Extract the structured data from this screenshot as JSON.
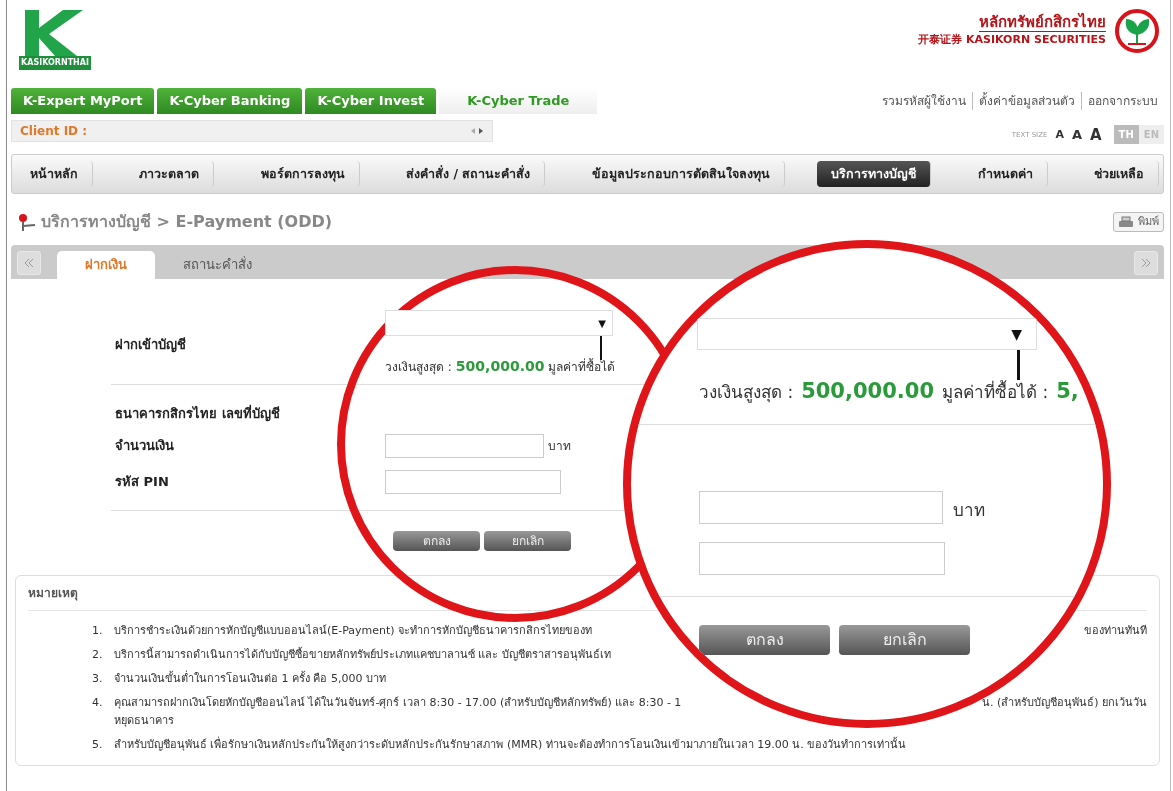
{
  "header": {
    "logo_caption": "KASIKORNTHAI",
    "brand_thai": "หลักทรัพย์กสิกรไทย",
    "brand_sub": "开泰证券 KASIKORN SECURITIES"
  },
  "product_tabs": [
    {
      "label": "K-Expert MyPort",
      "selected": false
    },
    {
      "label": "K-Cyber Banking",
      "selected": false
    },
    {
      "label": "K-Cyber Invest",
      "selected": false
    },
    {
      "label": "K-Cyber Trade",
      "selected": true
    }
  ],
  "user_links": [
    "รวมรหัสผู้ใช้งาน",
    "ตั้งค่าข้อมูลส่วนตัว",
    "ออกจากระบบ"
  ],
  "client_id": {
    "label": "Client ID :"
  },
  "text_size": {
    "label": "TEXT SIZE",
    "options": [
      {
        "label": "A",
        "kind": "small"
      },
      {
        "label": "A",
        "kind": "medium"
      },
      {
        "label": "A",
        "kind": "large"
      }
    ]
  },
  "languages": [
    {
      "label": "TH",
      "selected": true
    },
    {
      "label": "EN",
      "selected": false
    }
  ],
  "main_nav": [
    {
      "label": "หน้าหลัก",
      "selected": false
    },
    {
      "label": "ภาวะตลาด",
      "selected": false
    },
    {
      "label": "พอร์ตการลงทุน",
      "selected": false
    },
    {
      "label": "ส่งคำสั่ง / สถานะคำสั่ง",
      "selected": false
    },
    {
      "label": "ข้อมูลประกอบการตัดสินใจลงทุน",
      "selected": false
    },
    {
      "label": "บริการทางบัญชี",
      "selected": true
    },
    {
      "label": "กำหนดค่า",
      "selected": false
    },
    {
      "label": "ช่วยเหลือ",
      "selected": false
    }
  ],
  "breadcrumb": "บริการทางบัญชี > E-Payment (ODD)",
  "print_button": "พิมพ์",
  "sub_tabs": [
    {
      "label": "ฝากเงิน",
      "selected": true
    },
    {
      "label": "สถานะคำสั่ง",
      "selected": false
    }
  ],
  "form": {
    "account_label": "ฝากเข้าบัญชี",
    "caret": "▼",
    "limit": {
      "label": "วงเงินสูงสุด :",
      "amount": "500,000.00",
      "buyable_label": "มูลค่าที่ซื้อได้"
    },
    "bank_label": "ธนาคารกสิกรไทย เลขที่บัญชี",
    "amount_label": "จำนวนเงิน",
    "unit": "บาท",
    "pin_label": "รหัส PIN",
    "buttons": [
      "ตกลง",
      "ยกเลิก"
    ]
  },
  "magnifier": {
    "caret": "▼",
    "limit": {
      "label": "วงเงินสูงสุด :",
      "amount": "500,000.00",
      "buyable_label": "มูลค่าที่ซื้อได้ :",
      "buyable_amount": "5,"
    },
    "unit": "บาท",
    "buttons": [
      "ตกลง",
      "ยกเลิก"
    ]
  },
  "notes": {
    "title": "หมายเหตุ",
    "items": [
      {
        "number": "1.",
        "parts": [
          "บริการชำระเงินด้วยการหักบัญชีแบบออนไลน์(E-Payment) จะทำการหักบัญชีธนาคารกสิกรไทยของท",
          "ของท่านทันที"
        ]
      },
      {
        "number": "2.",
        "parts": [
          "บริการนี้สามารถดำเนินการได้กับบัญชีซื้อขายหลักทรัพย์ประเภทแคชบาลานซ์ และ บัญชีตราสารอนุพันธ์เท"
        ]
      },
      {
        "number": "3.",
        "parts": [
          "จำนวนเงินขั้นต่ำในการโอนเงินต่อ 1 ครั้ง คือ 5,000 บาท"
        ]
      },
      {
        "number": "4.",
        "parts": [
          "คุณสามารถฝากเงินโดยหักบัญชีออนไลน์ ได้ในวันจันทร์-ศุกร์ เวลา 8:30 - 17.00 (สำหรับบัญชีหลักทรัพย์) และ 8:30 - 1",
          "น. (สำหรับบัญชีอนุพันธ์) ยกเว้นวัน"
        ],
        "next_line": "หยุดธนาคาร"
      },
      {
        "number": "5.",
        "parts": [
          "สำหรับบัญชีอนุพันธ์ เพื่อรักษาเงินหลักประกันให้สูงกว่าระดับหลักประกันรักษาสภาพ (MMR) ท่านจะต้องทำการโอนเงินเข้ามาภายในเวลา 19.00 น. ของวันทำการเท่านั้น"
        ]
      }
    ]
  }
}
